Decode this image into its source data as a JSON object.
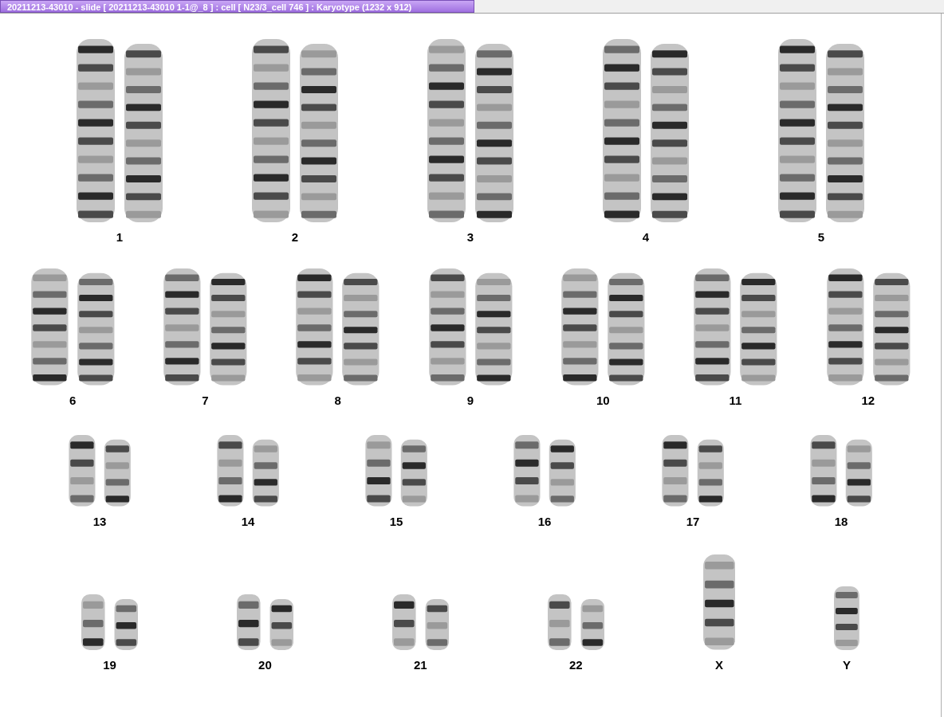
{
  "window": {
    "title": "20211213-43010 - slide [ 20211213-43010 1-1@_8 ] : cell [ N23/3_cell 746 ] : Karyotype  (1232 x 912)"
  },
  "rows": [
    {
      "labels": [
        "1",
        "2",
        "3",
        "4",
        "5"
      ]
    },
    {
      "labels": [
        "6",
        "7",
        "8",
        "9",
        "10",
        "11",
        "12"
      ]
    },
    {
      "labels": [
        "13",
        "14",
        "15",
        "16",
        "17",
        "18"
      ]
    },
    {
      "labels": [
        "19",
        "20",
        "21",
        "22",
        "X",
        "Y"
      ]
    }
  ]
}
